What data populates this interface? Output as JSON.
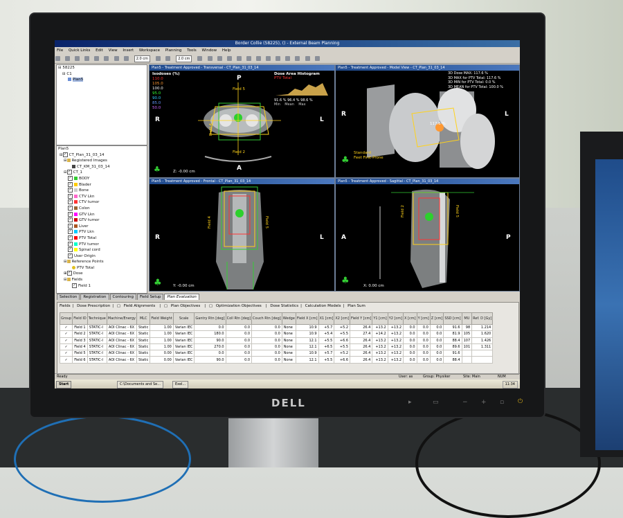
{
  "window": {
    "title": "Border Collie (58225), () - External Beam Planning"
  },
  "menu": [
    "File",
    "Quick Links",
    "Edit",
    "View",
    "Insert",
    "Workspace",
    "Planning",
    "Tools",
    "Window",
    "Help"
  ],
  "toolbar": {
    "zoom1": "2.0",
    "unit1": "cm",
    "zoom2": "2.0",
    "unit2": "cm"
  },
  "patient_tree": {
    "items": [
      {
        "label": "58225"
      },
      {
        "label": "C1"
      },
      {
        "label": "Plan5"
      }
    ]
  },
  "structure_tree": {
    "root": "Plan5",
    "plan": "CT_Plan_31_03_14",
    "registered": "Registered Images",
    "registered_item": "CT_KM_31_03_14",
    "image": "CT_1",
    "structures": [
      {
        "label": "BODY",
        "color": "#33cc33"
      },
      {
        "label": "Blader",
        "color": "#ffcc00"
      },
      {
        "label": "Bone",
        "color": "#cccccc"
      },
      {
        "label": "CTV Lkn",
        "color": "#ff66cc"
      },
      {
        "label": "CTV tumor",
        "color": "#ff3333"
      },
      {
        "label": "Colon",
        "color": "#996633"
      },
      {
        "label": "GTV Lkn",
        "color": "#ff00ff"
      },
      {
        "label": "GTV tumor",
        "color": "#cc0000"
      },
      {
        "label": "Liver",
        "color": "#aa5522"
      },
      {
        "label": "PTV Lkn",
        "color": "#00ccff"
      },
      {
        "label": "PTV Total",
        "color": "#ff0000"
      },
      {
        "label": "PTV tumor",
        "color": "#00ffcc"
      },
      {
        "label": "Spinal cord",
        "color": "#ffff00"
      }
    ],
    "user_origin": "User Origin",
    "reference_points": "Reference Points",
    "ref_item": "PTV Total",
    "dose": "Dose",
    "fields": "Fields",
    "field1": "Field 1"
  },
  "viewports": {
    "transversal": {
      "header": "Plan5 - Treatment Approved - Transversal - CT_Plan_31_03_14",
      "left": "R",
      "right": "L",
      "top": "P",
      "bottom": "A",
      "coord": "Z: -0.00 cm",
      "field_top": "Field 5",
      "field_left": "Field 4",
      "field_bottom": "Field 2"
    },
    "model": {
      "header": "Plan5 - Treatment Approved - Model View - CT_Plan_31_03_14",
      "left": "R",
      "right": "L",
      "orientation": "Standard",
      "position": "Feet First-Prone",
      "dose_line1": "3D Dose MAX: 117.6 %",
      "dose_line2": "3D MAX for PTV Total: 117.6 %",
      "dose_line3": "3D MIN for PTV Total: 0.0 %",
      "dose_line4": "3D MEAN for PTV Total: 100.0 %",
      "isodose_value": "117.6 %"
    },
    "frontal": {
      "header": "Plan5 - Treatment Approved - Frontal - CT_Plan_31_03_14",
      "left": "R",
      "right": "L",
      "coord": "Y: -0.00 cm",
      "field_left": "Field 4",
      "field_right": "Field 5"
    },
    "sagittal": {
      "header": "Plan5 - Treatment Approved - Sagittal - CT_Plan_31_03_14",
      "left": "A",
      "right": "P",
      "coord": "X: 0.00 cm",
      "field_left": "Field 2",
      "field_right": "Field 5"
    }
  },
  "isodoses": {
    "title": "Isodoses (%)",
    "levels": [
      {
        "v": "110.0",
        "c": "#ff3333"
      },
      {
        "v": "105.0",
        "c": "#ff9933"
      },
      {
        "v": "100.0",
        "c": "#ffffff"
      },
      {
        "v": "95.0",
        "c": "#33ff33"
      },
      {
        "v": "90.0",
        "c": "#33ccff"
      },
      {
        "v": "85.0",
        "c": "#6699ff"
      },
      {
        "v": "50.0",
        "c": "#cc66ff"
      }
    ]
  },
  "dvh": {
    "title": "Dose Area Histogram",
    "structure": "PTV Total",
    "min": "91.6 %",
    "mean": "96.4 %",
    "max": "98.6 %",
    "min_label": "Min",
    "mean_label": "Mean",
    "max_label": "Max"
  },
  "bottom_tabs": [
    "Selection",
    "Registration",
    "Contouring",
    "Field Setup",
    "Plan Evaluation"
  ],
  "field_tabs": [
    "Fields",
    "Dose Prescription",
    "Field Alignments",
    "Plan Objectives",
    "Optimization Objectives",
    "Dose Statistics",
    "Calculation Models",
    "Plan Sum"
  ],
  "table": {
    "headers": [
      "Group",
      "Field ID",
      "Technique",
      "Machine/Energy",
      "MLC",
      "Field Weight",
      "Scale",
      "Gantry Rtn [deg]",
      "Coll Rtn [deg]",
      "Couch Rtn [deg]",
      "Wedge",
      "Field X [cm]",
      "X1 [cm]",
      "X2 [cm]",
      "Field Y [cm]",
      "Y1 [cm]",
      "Y2 [cm]",
      "X [cm]",
      "Y [cm]",
      "Z [cm]",
      "SSD [cm]",
      "MU",
      "Ref. D [Gy]"
    ],
    "rows": [
      [
        "✓",
        "Field 1",
        "STATIC-I",
        "AOI Clinac - 6X",
        "Static",
        "1.00",
        "Varian IEC",
        "0.0",
        "0.0",
        "0.0",
        "None",
        "10.9",
        "+5.7",
        "+5.2",
        "26.4",
        "+13.2",
        "+13.2",
        "0.0",
        "0.0",
        "0.0",
        "91.6",
        "98",
        "1.214"
      ],
      [
        "✓",
        "Field 2",
        "STATIC-I",
        "AOI Clinac - 6X",
        "Static",
        "1.00",
        "Varian IEC",
        "180.0",
        "0.0",
        "0.0",
        "None",
        "10.9",
        "+5.4",
        "+5.5",
        "27.4",
        "+14.2",
        "+13.2",
        "0.0",
        "0.0",
        "0.0",
        "81.9",
        "105",
        "1.620"
      ],
      [
        "✓",
        "Field 3",
        "STATIC-I",
        "AOI Clinac - 6X",
        "Static",
        "1.00",
        "Varian IEC",
        "90.0",
        "0.0",
        "0.0",
        "None",
        "12.1",
        "+5.5",
        "+6.6",
        "26.4",
        "+13.2",
        "+13.2",
        "0.0",
        "0.0",
        "0.0",
        "88.4",
        "107",
        "1.426"
      ],
      [
        "✓",
        "Field 4",
        "STATIC-I",
        "AOI Clinac - 6X",
        "Static",
        "1.00",
        "Varian IEC",
        "270.0",
        "0.0",
        "0.0",
        "None",
        "12.1",
        "+6.5",
        "+5.5",
        "26.4",
        "+13.2",
        "+13.2",
        "0.0",
        "0.0",
        "0.0",
        "89.6",
        "101",
        "1.311"
      ],
      [
        "✓",
        "Field 5",
        "STATIC-I",
        "AOI Clinac - 6X",
        "Static",
        "0.00",
        "Varian IEC",
        "0.0",
        "0.0",
        "0.0",
        "None",
        "10.9",
        "+5.7",
        "+5.2",
        "26.4",
        "+13.2",
        "+13.2",
        "0.0",
        "0.0",
        "0.0",
        "91.6",
        "",
        ""
      ],
      [
        "✓",
        "Field 6",
        "STATIC-I",
        "AOI Clinac - 6X",
        "Static",
        "0.00",
        "Varian IEC",
        "90.0",
        "0.0",
        "0.0",
        "None",
        "12.1",
        "+5.5",
        "+6.6",
        "26.4",
        "+13.2",
        "+13.2",
        "0.0",
        "0.0",
        "0.0",
        "88.4",
        "",
        ""
      ]
    ]
  },
  "status": {
    "left": "Ready",
    "user": "User: as",
    "group": "Group: Physiker",
    "site": "Site: Main",
    "num": "NUM"
  },
  "taskbar": {
    "start": "Start",
    "task1": "C:\\Documents and Se...",
    "task2": "Exel...",
    "clock": "11:34"
  },
  "hardware": {
    "brand": "DELL"
  }
}
